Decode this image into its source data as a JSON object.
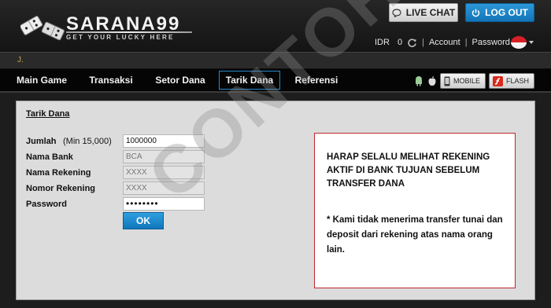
{
  "header": {
    "logo_name": "SARANA",
    "logo_number": "99",
    "logo_tagline": "GET YOUR LUCKY HERE",
    "live_chat_label": "LIVE CHAT",
    "logout_label": "LOG OUT",
    "currency": "IDR",
    "balance": "0",
    "account_label": "Account",
    "password_label": "Password"
  },
  "ticker": {
    "text": "J."
  },
  "nav": {
    "items": [
      "Main Game",
      "Transaksi",
      "Setor Dana",
      "Tarik Dana",
      "Referensi"
    ],
    "active": "Tarik Dana",
    "mobile_label": "MOBILE",
    "flash_label": "FLASH"
  },
  "form": {
    "title": "Tarik Dana",
    "amount_label": "Jumlah",
    "amount_hint": "(Min 15,000)",
    "amount_value": "1000000",
    "bank_label": "Nama Bank",
    "bank_value": "BCA",
    "account_name_label": "Nama Rekening",
    "account_name_value": "XXXX",
    "account_number_label": "Nomor Rekening",
    "account_number_value": "XXXX",
    "password_label": "Password",
    "password_value": "••••••••",
    "ok_label": "OK"
  },
  "notice": {
    "line1": "HARAP SELALU MELIHAT REKENING AKTIF DI BANK TUJUAN SEBELUM TRANSFER DANA",
    "line2": "* Kami tidak menerima transfer tunai dan deposit dari rekening atas nama orang lain."
  },
  "watermark": "CONTOH",
  "colors": {
    "accent_blue": "#1a86cc",
    "notice_border": "#c0282d",
    "flag_red": "#d81f26"
  }
}
